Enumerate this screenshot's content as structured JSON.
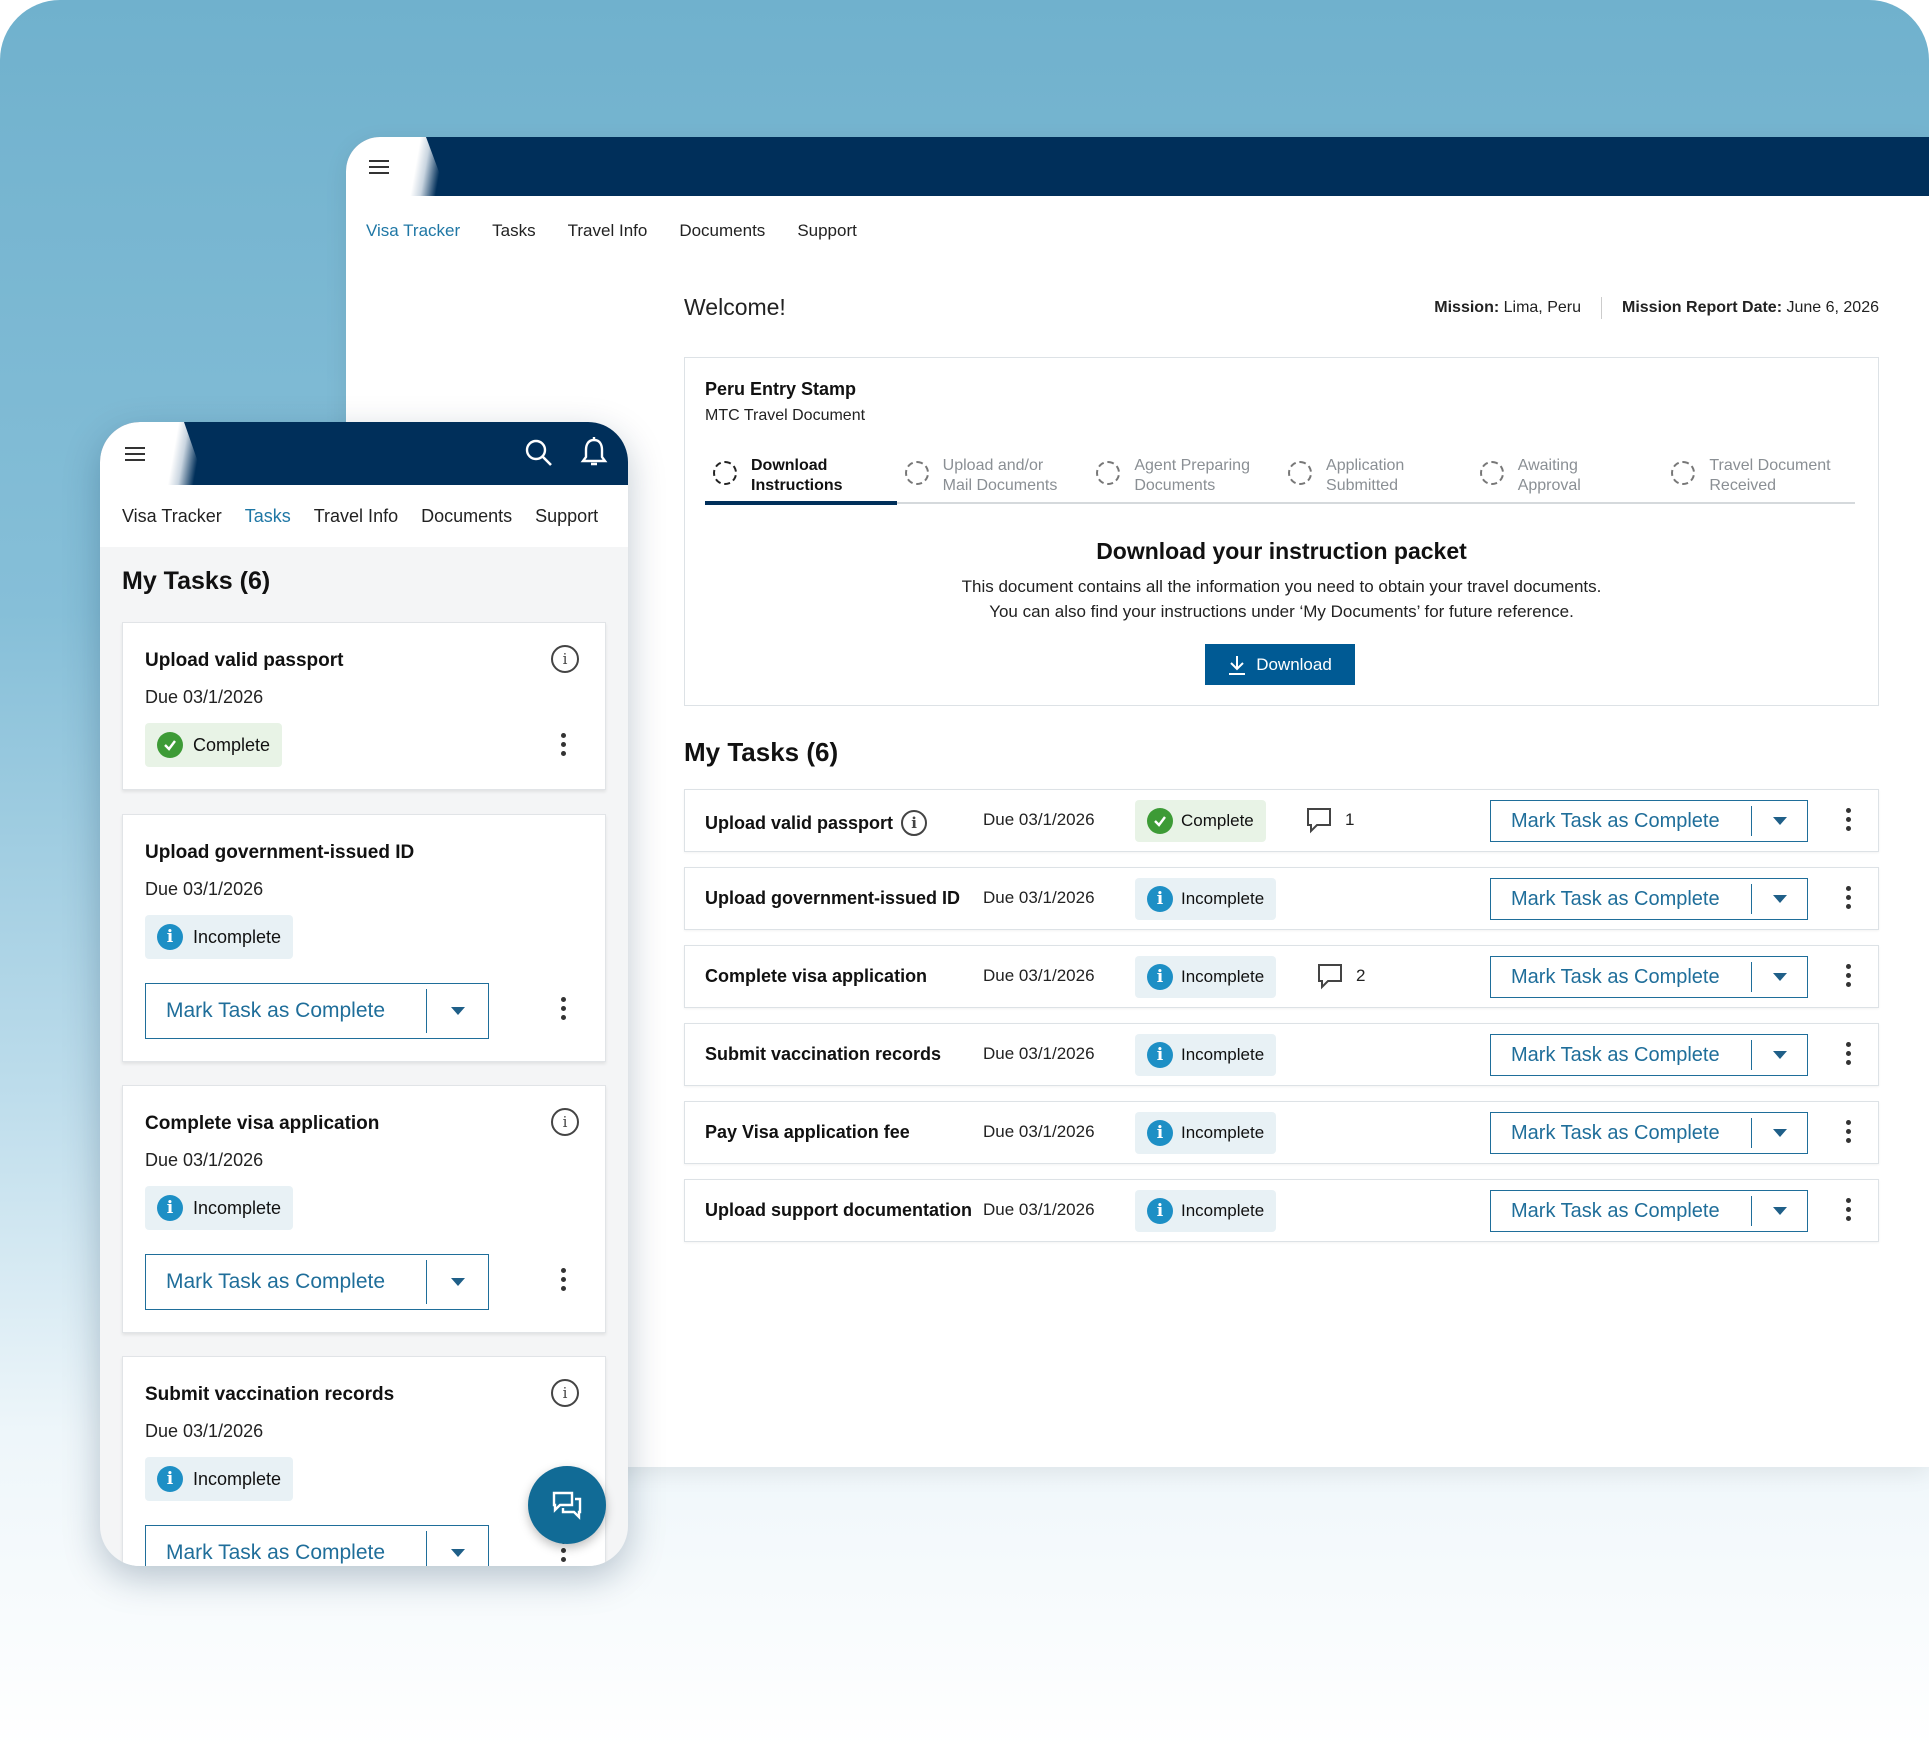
{
  "colors": {
    "navy": "#002f5a",
    "accent_link": "#1f77a5",
    "button_primary": "#005a94",
    "info_blue": "#1d8fc5",
    "success_green": "#3d9b36"
  },
  "desktop": {
    "nav": [
      "Visa Tracker",
      "Tasks",
      "Travel Info",
      "Documents",
      "Support"
    ],
    "active_nav": "Visa Tracker",
    "welcome": "Welcome!",
    "mission_label": "Mission:",
    "mission_value": "Lima, Peru",
    "report_label": "Mission Report Date:",
    "report_value": "June 6, 2026",
    "card": {
      "title": "Peru Entry Stamp",
      "subtitle": "MTC Travel Document",
      "steps": [
        {
          "l1": "Download",
          "l2": "Instructions",
          "active": true
        },
        {
          "l1": "Upload and/or",
          "l2": "Mail Documents",
          "active": false
        },
        {
          "l1": "Agent Preparing",
          "l2": "Documents",
          "active": false
        },
        {
          "l1": "Application",
          "l2": "Submitted",
          "active": false
        },
        {
          "l1": "Awaiting",
          "l2": "Approval",
          "active": false
        },
        {
          "l1": "Travel Document",
          "l2": "Received",
          "active": false
        }
      ],
      "heading": "Download your instruction packet",
      "line1": "This document contains all the information you need to obtain your travel documents.",
      "line2": "You can also find your instructions under ‘My Documents’ for future reference.",
      "button": "Download"
    },
    "tasks_title": "My Tasks (6)",
    "mark_label": "Mark Task as Complete",
    "tasks": [
      {
        "name": "Upload valid passport",
        "info": true,
        "due": "Due 03/1/2026",
        "status": "Complete",
        "comments": "1"
      },
      {
        "name": "Upload government-issued ID",
        "info": false,
        "due": "Due 03/1/2026",
        "status": "Incomplete",
        "comments": ""
      },
      {
        "name": "Complete visa application",
        "info": false,
        "due": "Due 03/1/2026",
        "status": "Incomplete",
        "comments": "2"
      },
      {
        "name": "Submit vaccination records",
        "info": false,
        "due": "Due 03/1/2026",
        "status": "Incomplete",
        "comments": ""
      },
      {
        "name": "Pay Visa application fee",
        "info": false,
        "due": "Due 03/1/2026",
        "status": "Incomplete",
        "comments": ""
      },
      {
        "name": "Upload support documentation",
        "info": false,
        "due": "Due 03/1/2026",
        "status": "Incomplete",
        "comments": ""
      }
    ]
  },
  "mobile": {
    "nav": [
      "Visa Tracker",
      "Tasks",
      "Travel Info",
      "Documents",
      "Support"
    ],
    "active_nav": "Tasks",
    "title": "My Tasks (6)",
    "mark_label": "Mark Task as Complete",
    "cards": [
      {
        "name": "Upload valid passport",
        "due": "Due 03/1/2026",
        "status": "Complete"
      },
      {
        "name": "Upload government-issued ID",
        "due": "Due 03/1/2026",
        "status": "Incomplete"
      },
      {
        "name": "Complete visa application",
        "due": "Due 03/1/2026",
        "status": "Incomplete"
      },
      {
        "name": "Submit vaccination records",
        "due": "Due 03/1/2026",
        "status": "Incomplete"
      }
    ]
  },
  "icons": [
    "hamburger-icon",
    "search-icon",
    "bell-icon",
    "info-icon",
    "check-circle-icon",
    "comment-icon",
    "download-icon",
    "chevron-down-icon",
    "more-vertical-icon",
    "chat-icon"
  ]
}
